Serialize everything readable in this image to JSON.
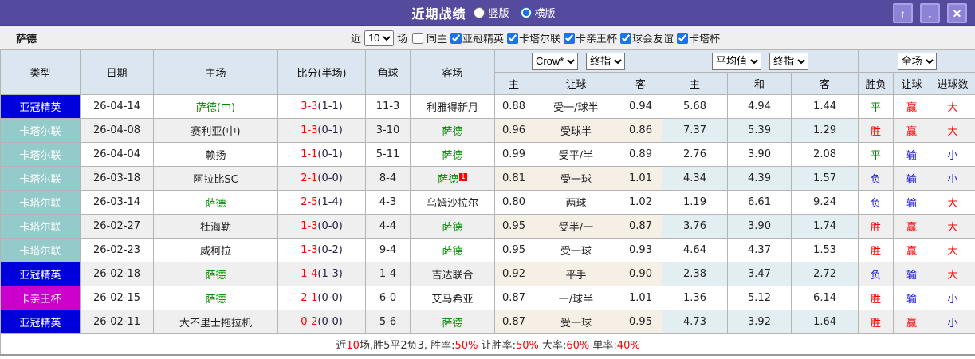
{
  "titlebar": {
    "title": "近期战绩",
    "radio_vertical_label": "竖版",
    "radio_horizontal_label": "横版",
    "up_icon": "↑",
    "down_icon": "↓",
    "close_icon": "✕",
    "bar_color": "#554b9e"
  },
  "filter": {
    "team": "萨德",
    "near_label": "近",
    "matches_value": "10",
    "matches_unit": "场",
    "same_home_label": "同主",
    "leagues": [
      "亚冠精英",
      "卡塔尔联",
      "卡亲王杯",
      "球会友谊",
      "卡塔杯"
    ]
  },
  "table": {
    "header": {
      "col_type": "类型",
      "col_date": "日期",
      "col_home": "主场",
      "col_score": "比分(半场)",
      "col_corner": "角球",
      "col_away": "客场",
      "dd_company": "Crow*",
      "dd_final_company": "终指",
      "dd_average": "平均值",
      "dd_final_avg": "终指",
      "dd_fulltime": "全场",
      "sub": [
        "主",
        "让球",
        "客",
        "主",
        "和",
        "客",
        "胜负",
        "让球",
        "进球数"
      ]
    },
    "legend_colors": {
      "acl_elite": "#0000dd",
      "qatar_league": "#94cbca",
      "emir_cup": "#cc00cc"
    },
    "rows": [
      {
        "league": "亚冠精英",
        "league_color": "blue",
        "date": "26-04-14",
        "home": "萨德(中)",
        "home_green": true,
        "score": "3-3",
        "half": "(1-1)",
        "corner": "11-3",
        "away": "利雅得新月",
        "away_green": false,
        "away_badge": "",
        "odds_home": "0.88",
        "handicap": "受一/球半",
        "odds_away": "0.94",
        "avg_home": "5.68",
        "avg_draw": "4.94",
        "avg_away": "1.44",
        "result": "平",
        "result_color": "green",
        "handicap_result": "赢",
        "handicap_result_color": "red",
        "goals": "大",
        "goals_color": "red"
      },
      {
        "league": "卡塔尔联",
        "league_color": "teal",
        "date": "26-04-08",
        "home": "赛利亚(中)",
        "home_green": false,
        "score": "1-3",
        "half": "(0-1)",
        "corner": "3-10",
        "away": "萨德",
        "away_green": true,
        "away_badge": "",
        "odds_home": "0.96",
        "handicap": "受球半",
        "odds_away": "0.86",
        "avg_home": "7.37",
        "avg_draw": "5.39",
        "avg_away": "1.29",
        "result": "胜",
        "result_color": "red",
        "handicap_result": "赢",
        "handicap_result_color": "red",
        "goals": "大",
        "goals_color": "red"
      },
      {
        "league": "卡塔尔联",
        "league_color": "teal",
        "date": "26-04-04",
        "home": "赖扬",
        "home_green": false,
        "score": "1-1",
        "half": "(0-1)",
        "corner": "5-11",
        "away": "萨德",
        "away_green": true,
        "away_badge": "",
        "odds_home": "0.99",
        "handicap": "受平/半",
        "odds_away": "0.89",
        "avg_home": "2.76",
        "avg_draw": "3.90",
        "avg_away": "2.08",
        "result": "平",
        "result_color": "green",
        "handicap_result": "输",
        "handicap_result_color": "blue",
        "goals": "小",
        "goals_color": "blue"
      },
      {
        "league": "卡塔尔联",
        "league_color": "teal",
        "date": "26-03-18",
        "home": "阿拉比SC",
        "home_green": false,
        "score": "2-1",
        "half": "(0-0)",
        "corner": "8-4",
        "away": "萨德",
        "away_green": true,
        "away_badge": "1",
        "odds_home": "0.81",
        "handicap": "受一球",
        "odds_away": "1.01",
        "avg_home": "4.34",
        "avg_draw": "4.39",
        "avg_away": "1.57",
        "result": "负",
        "result_color": "blue",
        "handicap_result": "输",
        "handicap_result_color": "blue",
        "goals": "小",
        "goals_color": "blue"
      },
      {
        "league": "卡塔尔联",
        "league_color": "teal",
        "date": "26-03-14",
        "home": "萨德",
        "home_green": true,
        "score": "2-5",
        "half": "(1-4)",
        "corner": "4-3",
        "away": "乌姆沙拉尔",
        "away_green": false,
        "away_badge": "",
        "odds_home": "0.80",
        "handicap": "两球",
        "odds_away": "1.02",
        "avg_home": "1.19",
        "avg_draw": "6.61",
        "avg_away": "9.24",
        "result": "负",
        "result_color": "blue",
        "handicap_result": "输",
        "handicap_result_color": "blue",
        "goals": "大",
        "goals_color": "red"
      },
      {
        "league": "卡塔尔联",
        "league_color": "teal",
        "date": "26-02-27",
        "home": "杜海勒",
        "home_green": false,
        "score": "1-3",
        "half": "(0-0)",
        "corner": "4-4",
        "away": "萨德",
        "away_green": true,
        "away_badge": "",
        "odds_home": "0.95",
        "handicap": "受半/一",
        "odds_away": "0.87",
        "avg_home": "3.76",
        "avg_draw": "3.90",
        "avg_away": "1.74",
        "result": "胜",
        "result_color": "red",
        "handicap_result": "赢",
        "handicap_result_color": "red",
        "goals": "大",
        "goals_color": "red"
      },
      {
        "league": "卡塔尔联",
        "league_color": "teal",
        "date": "26-02-23",
        "home": "威柯拉",
        "home_green": false,
        "score": "1-3",
        "half": "(0-2)",
        "corner": "9-4",
        "away": "萨德",
        "away_green": true,
        "away_badge": "",
        "odds_home": "0.95",
        "handicap": "受一球",
        "odds_away": "0.93",
        "avg_home": "4.64",
        "avg_draw": "4.37",
        "avg_away": "1.53",
        "result": "胜",
        "result_color": "red",
        "handicap_result": "赢",
        "handicap_result_color": "red",
        "goals": "大",
        "goals_color": "red"
      },
      {
        "league": "亚冠精英",
        "league_color": "blue",
        "date": "26-02-18",
        "home": "萨德",
        "home_green": true,
        "score": "1-4",
        "half": "(1-3)",
        "corner": "1-4",
        "away": "吉达联合",
        "away_green": false,
        "away_badge": "",
        "odds_home": "0.92",
        "handicap": "平手",
        "odds_away": "0.90",
        "avg_home": "2.38",
        "avg_draw": "3.47",
        "avg_away": "2.72",
        "result": "负",
        "result_color": "blue",
        "handicap_result": "输",
        "handicap_result_color": "blue",
        "goals": "大",
        "goals_color": "red"
      },
      {
        "league": "卡亲王杯",
        "league_color": "magenta",
        "date": "26-02-15",
        "home": "萨德",
        "home_green": true,
        "score": "2-1",
        "half": "(0-0)",
        "corner": "6-0",
        "away": "艾马希亚",
        "away_green": false,
        "away_badge": "",
        "odds_home": "0.87",
        "handicap": "一/球半",
        "odds_away": "1.01",
        "avg_home": "1.36",
        "avg_draw": "5.12",
        "avg_away": "6.14",
        "result": "胜",
        "result_color": "red",
        "handicap_result": "输",
        "handicap_result_color": "blue",
        "goals": "小",
        "goals_color": "blue"
      },
      {
        "league": "亚冠精英",
        "league_color": "blue",
        "date": "26-02-11",
        "home": "大不里士拖拉机",
        "home_green": false,
        "score": "0-2",
        "half": "(0-0)",
        "corner": "5-6",
        "away": "萨德",
        "away_green": true,
        "away_badge": "",
        "odds_home": "0.87",
        "handicap": "受一球",
        "odds_away": "0.95",
        "avg_home": "4.73",
        "avg_draw": "3.92",
        "avg_away": "1.64",
        "result": "胜",
        "result_color": "red",
        "handicap_result": "赢",
        "handicap_result_color": "red",
        "goals": "小",
        "goals_color": "blue"
      }
    ]
  },
  "footer": {
    "segments": [
      {
        "text": "近",
        "red": false
      },
      {
        "text": "10",
        "red": true
      },
      {
        "text": "场,胜5平2负3, 胜率:",
        "red": false
      },
      {
        "text": "50%",
        "red": true
      },
      {
        "text": " 让胜率:",
        "red": false
      },
      {
        "text": "50%",
        "red": true
      },
      {
        "text": " 大率:",
        "red": false
      },
      {
        "text": "60%",
        "red": true
      },
      {
        "text": " 单率:",
        "red": false
      },
      {
        "text": "40%",
        "red": true
      }
    ]
  }
}
